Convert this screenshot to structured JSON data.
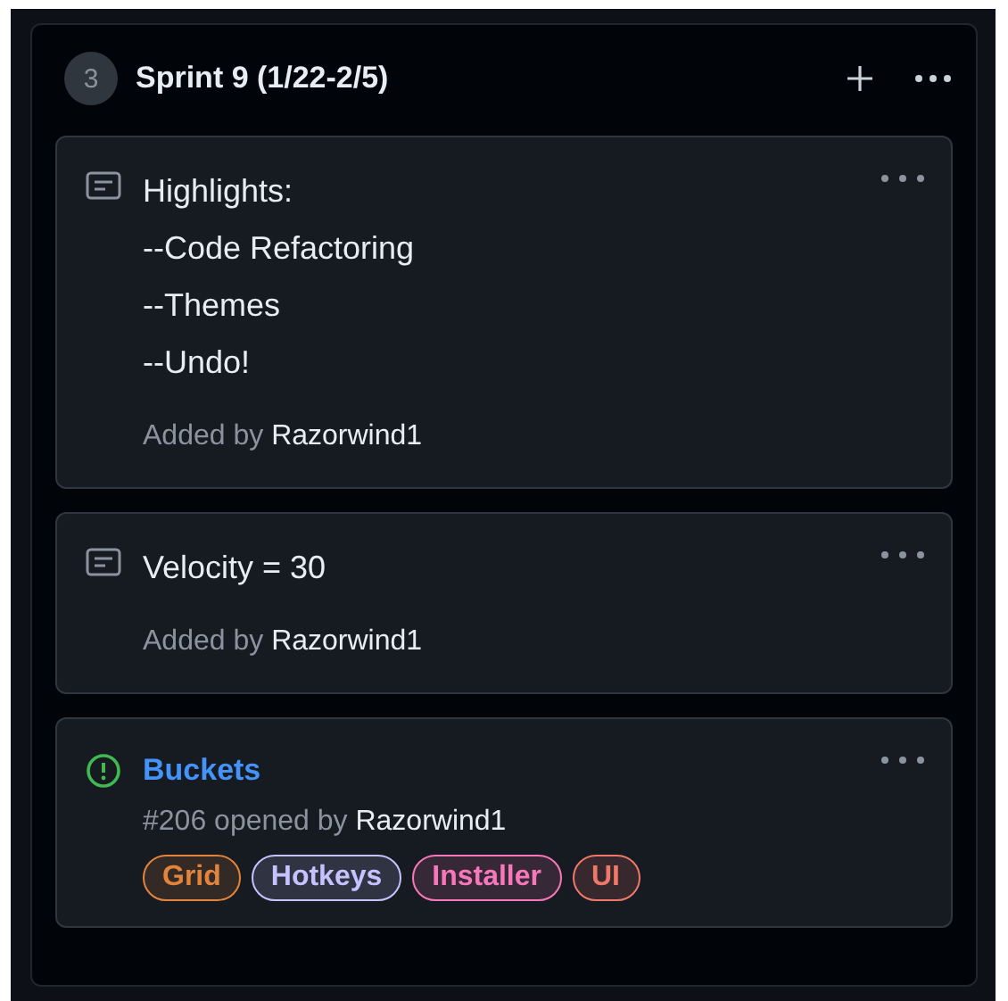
{
  "column": {
    "count": "3",
    "title": "Sprint 9 (1/22-2/5)"
  },
  "cards": [
    {
      "kind": "note",
      "lines": [
        "Highlights:",
        "--Code Refactoring",
        "--Themes",
        "--Undo!"
      ],
      "meta": "Added by",
      "author": "Razorwind1"
    },
    {
      "kind": "note",
      "lines": [
        "Velocity = 30"
      ],
      "meta": "Added by",
      "author": "Razorwind1"
    },
    {
      "kind": "issue",
      "title": "Buckets",
      "meta": "#206 opened by",
      "author": "Razorwind1",
      "labels": [
        {
          "name": "Grid",
          "color": "#e3843d"
        },
        {
          "name": "Hotkeys",
          "color": "#c7c1ff"
        },
        {
          "name": "Installer",
          "color": "#f778ba"
        },
        {
          "name": "UI",
          "color": "#f0786a"
        }
      ]
    }
  ]
}
